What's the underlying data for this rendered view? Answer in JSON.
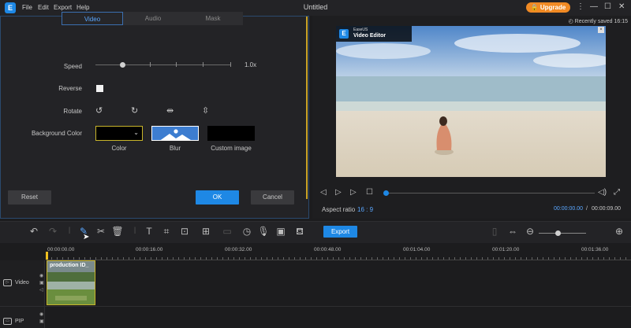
{
  "app": {
    "logo_text": "E",
    "title": "Untitled",
    "menu": [
      "File",
      "Edit",
      "Export",
      "Help"
    ],
    "upgrade_label": "Upgrade",
    "saved_status": "Recently saved 16:15"
  },
  "settings": {
    "tabs": [
      "Video",
      "Audio",
      "Mask"
    ],
    "active_tab": "Video",
    "speed_label": "Speed",
    "speed_value": "1.0x",
    "reverse_label": "Reverse",
    "rotate_label": "Rotate",
    "background_label": "Background Color",
    "background_options": [
      "Color",
      "Blur",
      "Custom image"
    ],
    "reset_label": "Reset",
    "ok_label": "OK",
    "cancel_label": "Cancel"
  },
  "preview": {
    "watermark_small": "EaseUS",
    "watermark_main": "Video Editor",
    "aspect_label": "Aspect ratio",
    "aspect_value": "16 : 9",
    "current_time": "00:00:00.00",
    "time_separator": "/",
    "total_time": "00:00:09.00",
    "playback_progress": 0
  },
  "toolbar": {
    "export_label": "Export"
  },
  "timeline": {
    "ruler": [
      "00:00:00.00",
      "00:00:16.00",
      "00:00:32.00",
      "00:00:48.00",
      "00:01:04.00",
      "00:01:20.00",
      "00:01:36.00"
    ],
    "tracks": [
      {
        "name": "Video"
      },
      {
        "name": "PIP"
      }
    ],
    "clip_label": "production ID_"
  },
  "colors": {
    "accent": "#1e88e5",
    "upgrade": "#f08a24",
    "selection": "#c9b52a"
  }
}
